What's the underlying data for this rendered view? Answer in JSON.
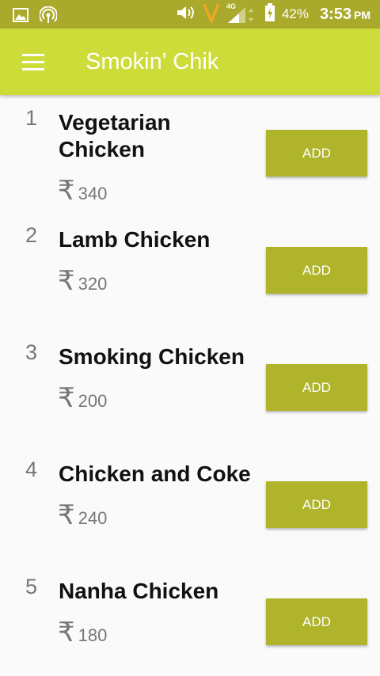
{
  "status_bar": {
    "network_label": "4G",
    "battery": "42%",
    "time": "3:53",
    "ampm": "PM"
  },
  "app_bar": {
    "title": "Smokin' Chik"
  },
  "items": [
    {
      "number": "1",
      "name": "Vegetarian Chicken",
      "currency": "₹",
      "price": "340",
      "button": "ADD"
    },
    {
      "number": "2",
      "name": "Lamb Chicken",
      "currency": "₹",
      "price": "320",
      "button": "ADD"
    },
    {
      "number": "3",
      "name": "Smoking Chicken",
      "currency": "₹",
      "price": "200",
      "button": "ADD"
    },
    {
      "number": "4",
      "name": "Chicken and Coke",
      "currency": "₹",
      "price": "240",
      "button": "ADD"
    },
    {
      "number": "5",
      "name": "Nanha Chicken",
      "currency": "₹",
      "price": "180",
      "button": "ADD"
    }
  ],
  "colors": {
    "status_bar": "#a9a92b",
    "app_bar": "#cddc39",
    "add_button": "#afb42b"
  }
}
